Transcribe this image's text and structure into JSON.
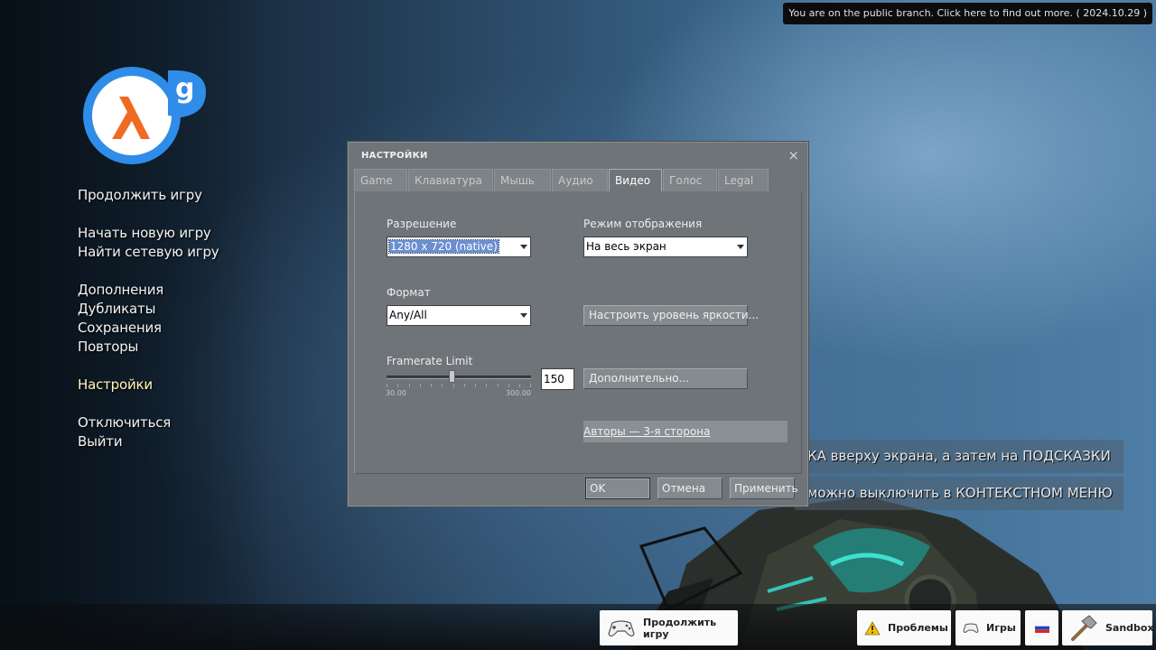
{
  "banner": {
    "text": "You are on the public branch. Click here to find out more. ( 2024.10.29 )"
  },
  "logo": {
    "letter": "g",
    "colors": {
      "ring": "#2f8ce8",
      "lambda": "#f06a22"
    }
  },
  "main_menu": {
    "items": [
      {
        "label": "Продолжить игру"
      },
      {
        "label": "Начать новую игру"
      },
      {
        "label": "Найти сетевую игру"
      },
      {
        "label": "Дополнения"
      },
      {
        "label": "Дубликаты"
      },
      {
        "label": "Сохранения"
      },
      {
        "label": "Повторы"
      },
      {
        "label": "Настройки",
        "active": true
      },
      {
        "label": "Отключиться"
      },
      {
        "label": "Выйти"
      }
    ]
  },
  "hints": [
    "КА вверху экрана, а затем на ПОДСКАЗКИ",
    "можно выключить в КОНТЕКСТНОМ МЕНЮ"
  ],
  "dialog": {
    "title": "НАСТРОЙКИ",
    "close_glyph": "×",
    "tabs": [
      {
        "label": "Game"
      },
      {
        "label": "Клавиатура"
      },
      {
        "label": "Мышь"
      },
      {
        "label": "Аудио"
      },
      {
        "label": "Видео",
        "active": true
      },
      {
        "label": "Голос"
      },
      {
        "label": "Legal"
      }
    ],
    "video": {
      "resolution_label": "Разрешение",
      "resolution_value": "1280 x 720 (native)",
      "display_mode_label": "Режим отображения",
      "display_mode_value": "На весь экран",
      "aspect_label": "Формат",
      "aspect_value": "Any/All",
      "brightness_button": "Настроить уровень яркости...",
      "framerate_label": "Framerate Limit",
      "framerate_min": "30.00",
      "framerate_max": "300.00",
      "framerate_value": "150",
      "advanced_button": "Дополнительно...",
      "credits_link": "Авторы — 3-я сторона"
    },
    "buttons": {
      "ok": "OK",
      "cancel": "Отмена",
      "apply": "Применить"
    }
  },
  "bottom_bar": {
    "continue": "Продолжить игру",
    "problems": "Проблемы",
    "games": "Игры",
    "sandbox": "Sandbox"
  }
}
